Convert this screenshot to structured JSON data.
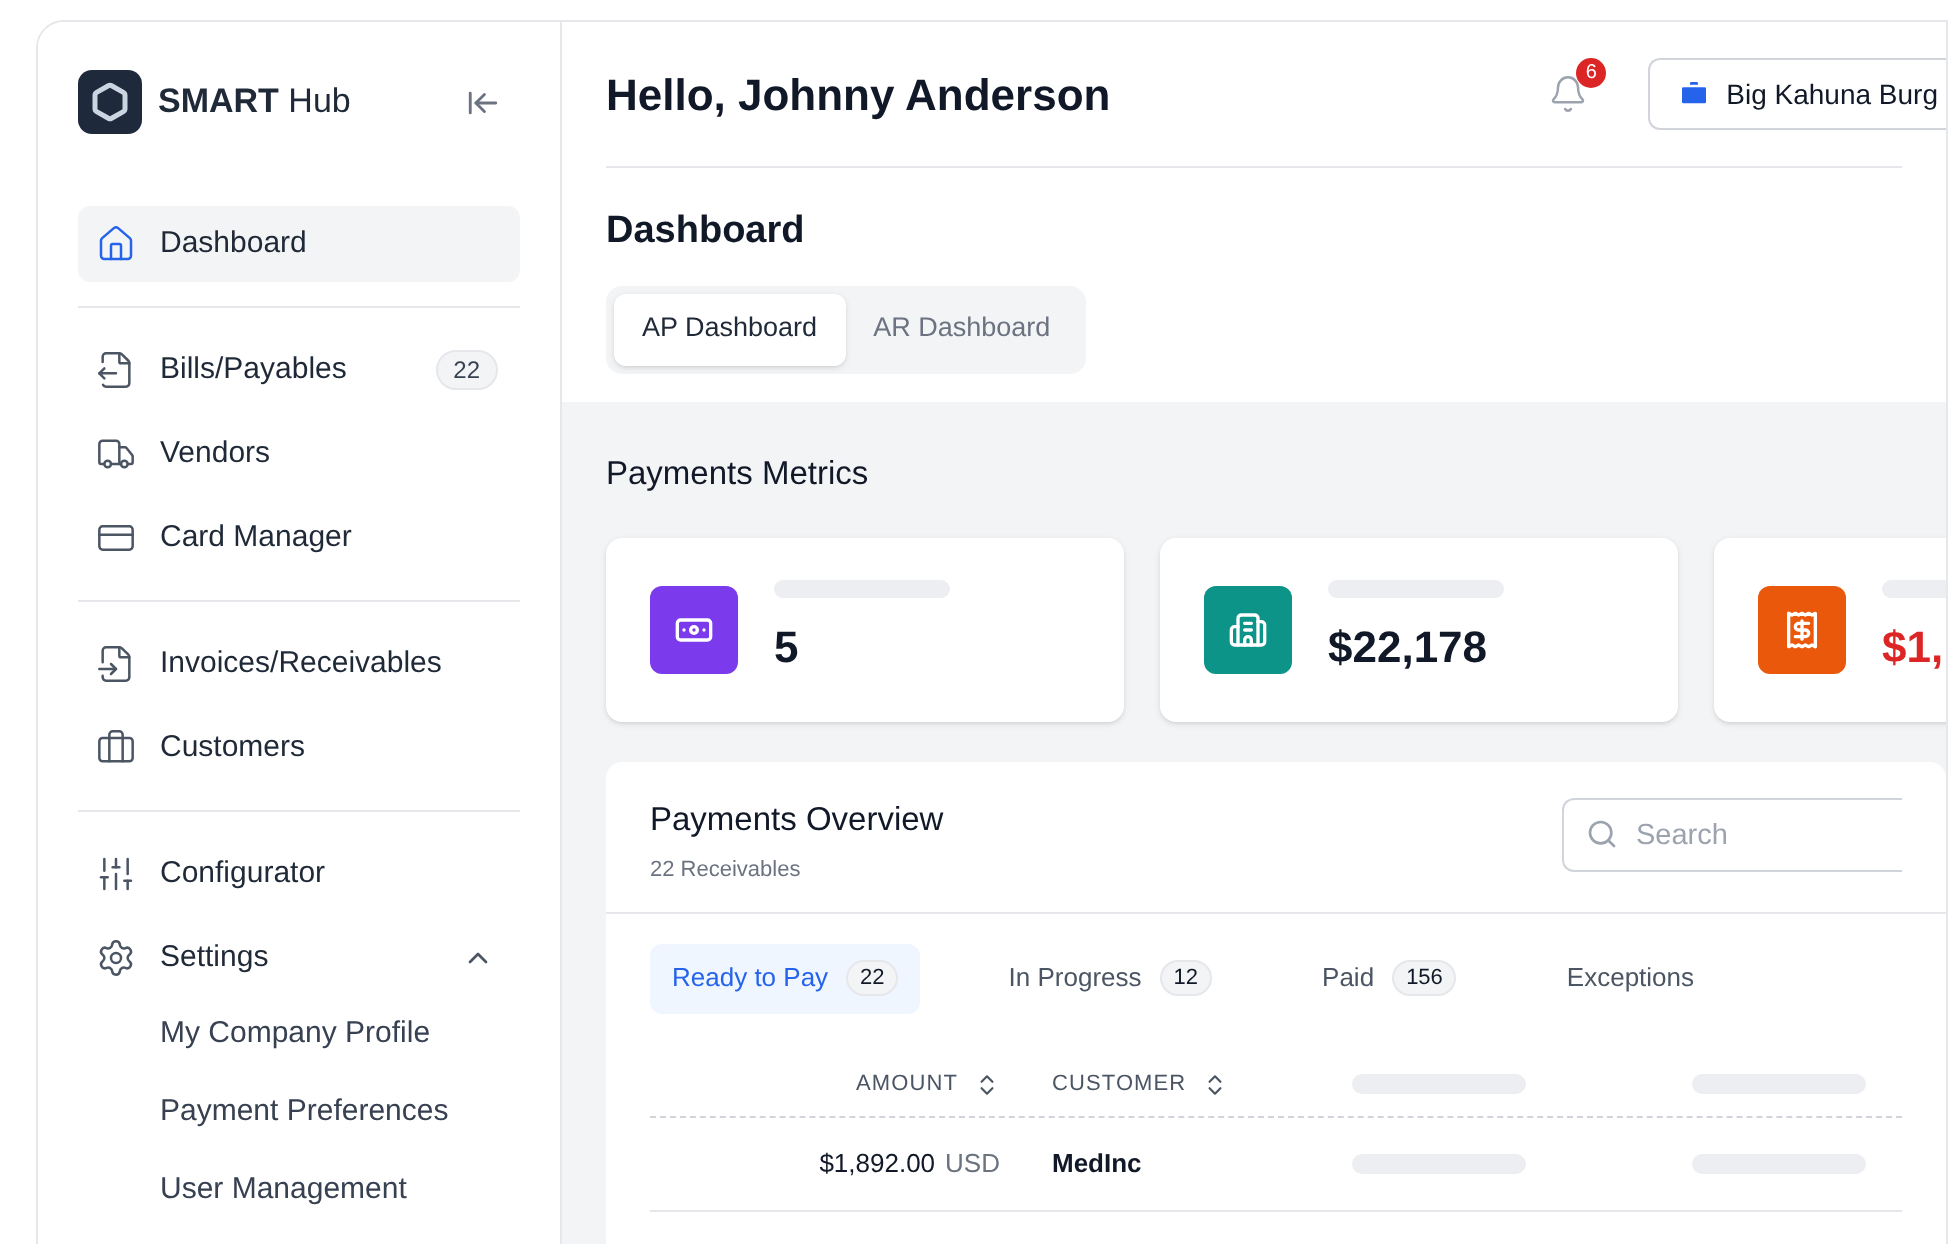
{
  "sidebar": {
    "brand": {
      "bold": "SMART",
      "rest": "Hub"
    },
    "groups": [
      [
        {
          "kind": "home",
          "label": "Dashboard",
          "selected": true
        }
      ],
      [
        {
          "kind": "bills",
          "label": "Bills/Payables",
          "badge": "22",
          "selected": false
        },
        {
          "kind": "truck",
          "label": "Vendors",
          "selected": false
        },
        {
          "kind": "card",
          "label": "Card Manager",
          "selected": false
        }
      ],
      [
        {
          "kind": "invoices",
          "label": "Invoices/Receivables",
          "selected": false
        },
        {
          "kind": "briefcase",
          "label": "Customers",
          "selected": false
        }
      ],
      [
        {
          "kind": "sliders",
          "label": "Configurator",
          "selected": false
        },
        {
          "kind": "settings",
          "label": "Settings",
          "selected": false,
          "expanded": true,
          "children": [
            {
              "label": "My Company Profile"
            },
            {
              "label": "Payment Preferences"
            },
            {
              "label": "User Management"
            }
          ]
        }
      ]
    ]
  },
  "header": {
    "greeting": "Hello, Johnny Anderson",
    "notifications": "6",
    "company": "Big Kahuna Burg"
  },
  "page_title": "Dashboard",
  "tabs": [
    {
      "label": "AP Dashboard",
      "selected": true
    },
    {
      "label": "AR Dashboard",
      "selected": false
    }
  ],
  "metrics": {
    "title": "Payments Metrics",
    "cards": [
      {
        "kind": "cash",
        "color": "#7c3aed",
        "value": "5",
        "negative": false
      },
      {
        "kind": "building",
        "color": "#0d9488",
        "value": "$22,178",
        "negative": false
      },
      {
        "kind": "receipt",
        "color": "#ea580c",
        "value": "$1,",
        "negative": true
      }
    ]
  },
  "overview": {
    "title": "Payments Overview",
    "subtitle": "22 Receivables",
    "search": {
      "placeholder": "Search"
    },
    "tabs": [
      {
        "label": "Ready to Pay",
        "count": "22",
        "selected": true
      },
      {
        "label": "In Progress",
        "count": "12",
        "selected": false
      },
      {
        "label": "Paid",
        "count": "156",
        "selected": false
      },
      {
        "label": "Exceptions",
        "selected": false
      }
    ],
    "columns": [
      {
        "label": "AMOUNT",
        "sortable": true
      },
      {
        "label": "CUSTOMER",
        "sortable": true
      }
    ],
    "rows": [
      {
        "amount": "$1,892.00",
        "currency": "USD",
        "customer": "MedInc"
      }
    ]
  }
}
